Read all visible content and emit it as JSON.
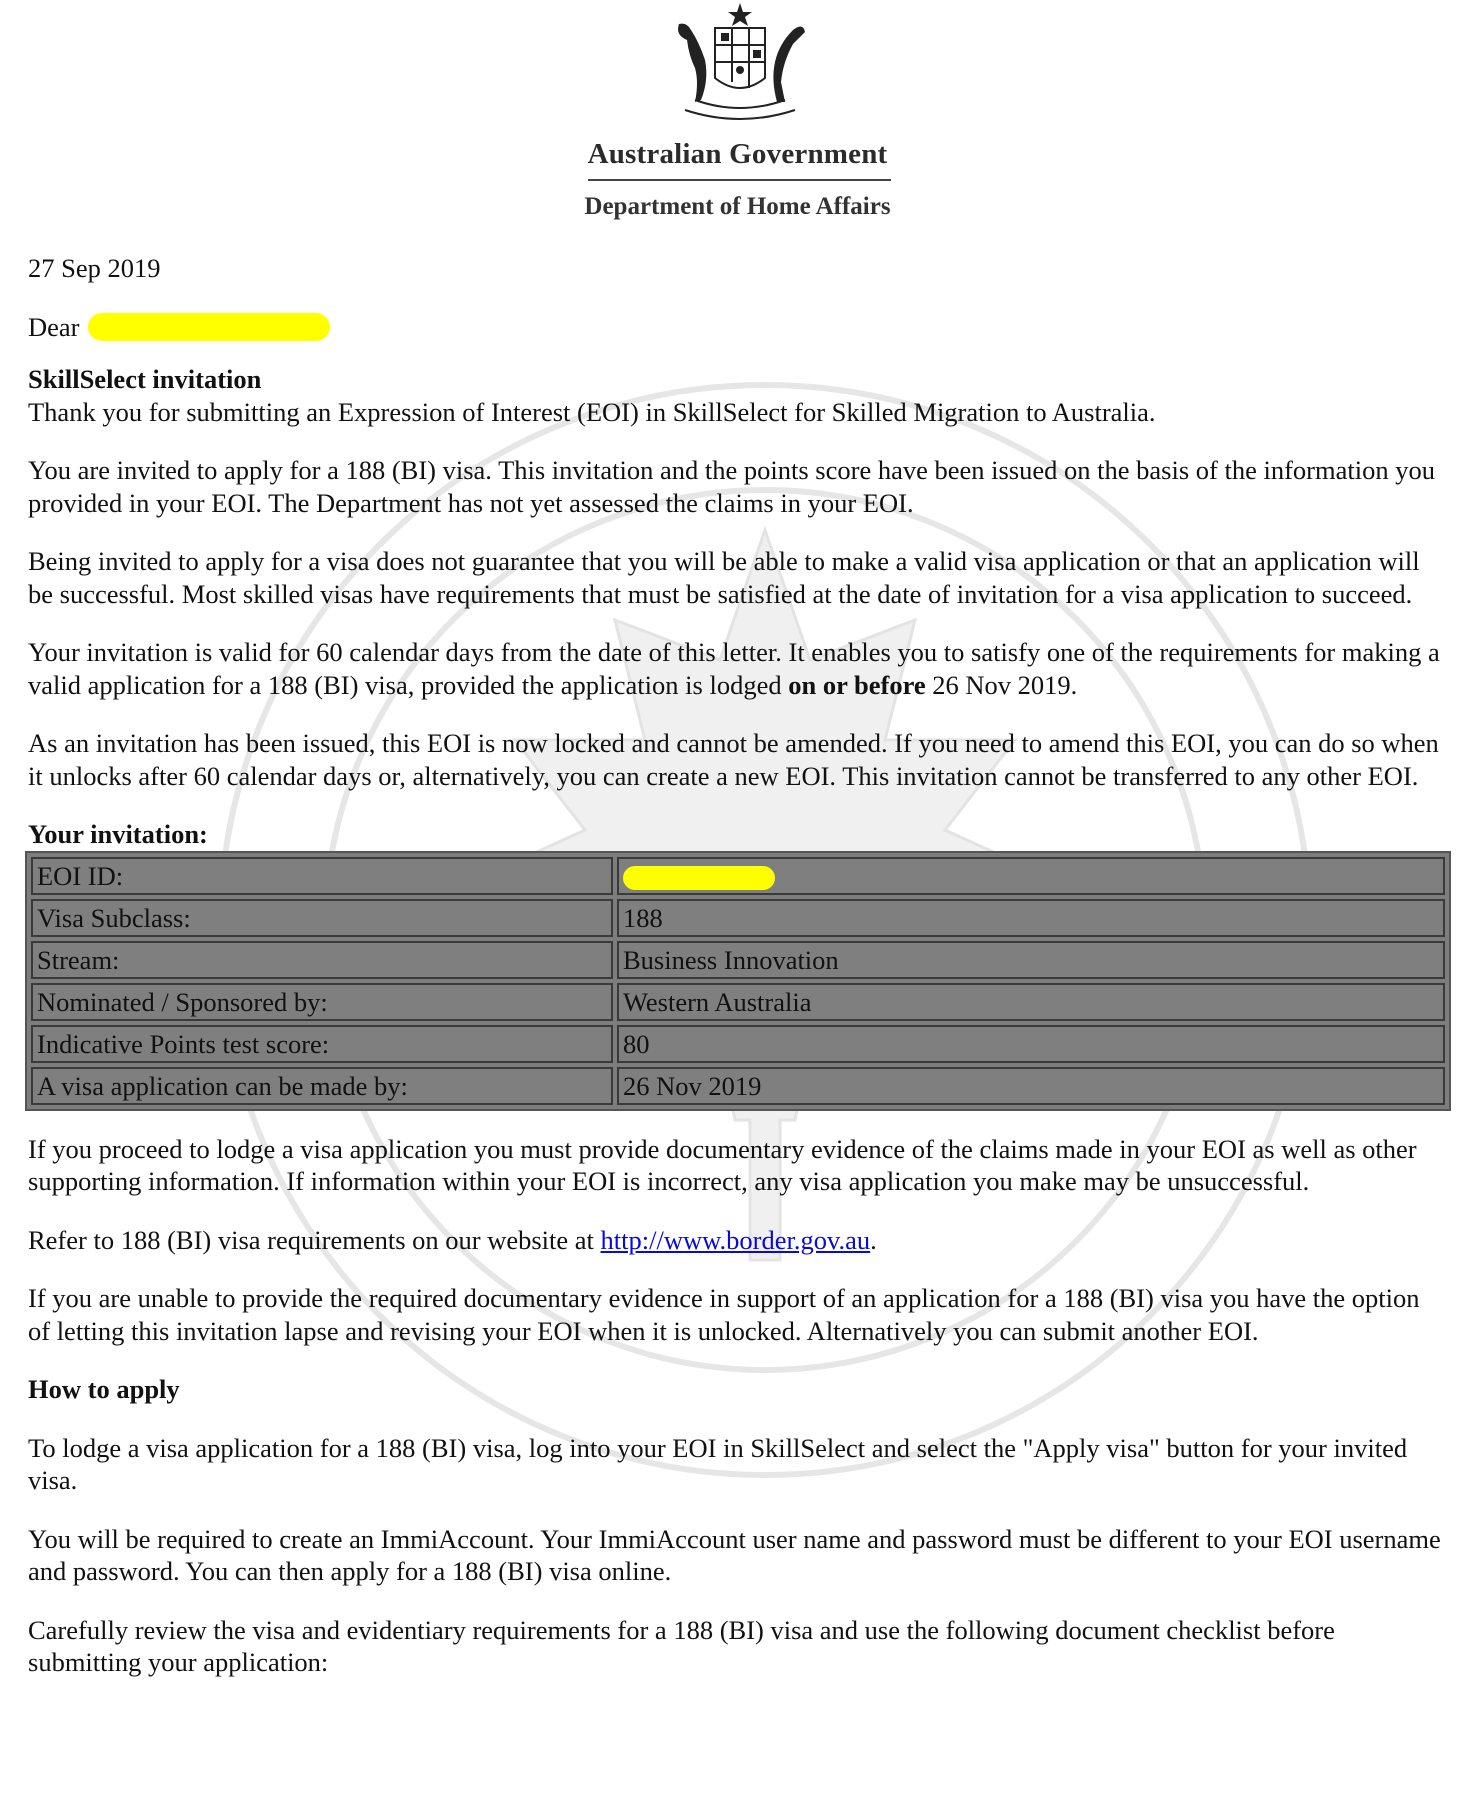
{
  "header": {
    "government": "Australian Government",
    "department": "Department of Home Affairs"
  },
  "letter": {
    "date": "27 Sep 2019",
    "salutation": "Dear",
    "subject": "SkillSelect invitation",
    "p1": "Thank you for submitting an Expression of Interest (EOI) in SkillSelect for Skilled Migration to Australia.",
    "p2": "You are invited to apply for a 188 (BI) visa. This invitation and the points score have been issued on the basis of the information you provided in your EOI. The Department has not yet assessed the claims in your EOI.",
    "p3": "Being invited to apply for a visa does not guarantee that you will be able to make a valid visa application or that an application will be successful. Most skilled visas have requirements that must be satisfied at the date of invitation for a visa application to succeed.",
    "p4_a": "Your invitation is valid for 60 calendar days from the date of this letter. It enables you to satisfy one of the requirements for making a valid application for a 188 (BI) visa, provided the application is lodged ",
    "p4_b": "on or before",
    "p4_c": " 26 Nov 2019.",
    "p5": "As an invitation has been issued, this EOI is now locked and cannot be amended. If you need to amend this EOI, you can do so when it unlocks after 60 calendar days or, alternatively, you can create a new EOI. This invitation cannot be transferred to any other EOI.",
    "invitation_heading": "Your invitation:",
    "p6": "If you proceed to lodge a visa application you must provide documentary evidence of the claims made in your EOI as well as other supporting information. If information within your EOI is incorrect, any visa application you make may be unsuccessful.",
    "p7_a": "Refer to 188 (BI) visa requirements on our website at ",
    "p7_link": "http://www.border.gov.au",
    "p7_c": ".",
    "p8": "If you are unable to provide the required documentary evidence in support of an application for a 188 (BI) visa you have the option of letting this invitation lapse and revising your EOI when it is unlocked. Alternatively you can submit another EOI.",
    "how_heading": "How to apply",
    "p9": "To lodge a visa application for a 188 (BI) visa, log into your EOI in SkillSelect and select the \"Apply visa\" button for your invited visa.",
    "p10": "You will be required to create an ImmiAccount. Your ImmiAccount user name and password must be different to your EOI username and password. You can then apply for a 188 (BI) visa online.",
    "p11": "Carefully review the visa and evidentiary requirements for a 188 (BI) visa and use the following document checklist before submitting your application:"
  },
  "invitation": {
    "rows": [
      {
        "label": "EOI ID:",
        "value": ""
      },
      {
        "label": "Visa Subclass:",
        "value": "188"
      },
      {
        "label": "Stream:",
        "value": "Business Innovation"
      },
      {
        "label": "Nominated / Sponsored by:",
        "value": "Western Australia"
      },
      {
        "label": "Indicative Points test score:",
        "value": "80"
      },
      {
        "label": "A visa application can be made by:",
        "value": "26 Nov 2019"
      }
    ]
  },
  "colors": {
    "redaction": "#ffff00",
    "table_cell": "#7f7f7f",
    "link": "#0a0ad8"
  }
}
